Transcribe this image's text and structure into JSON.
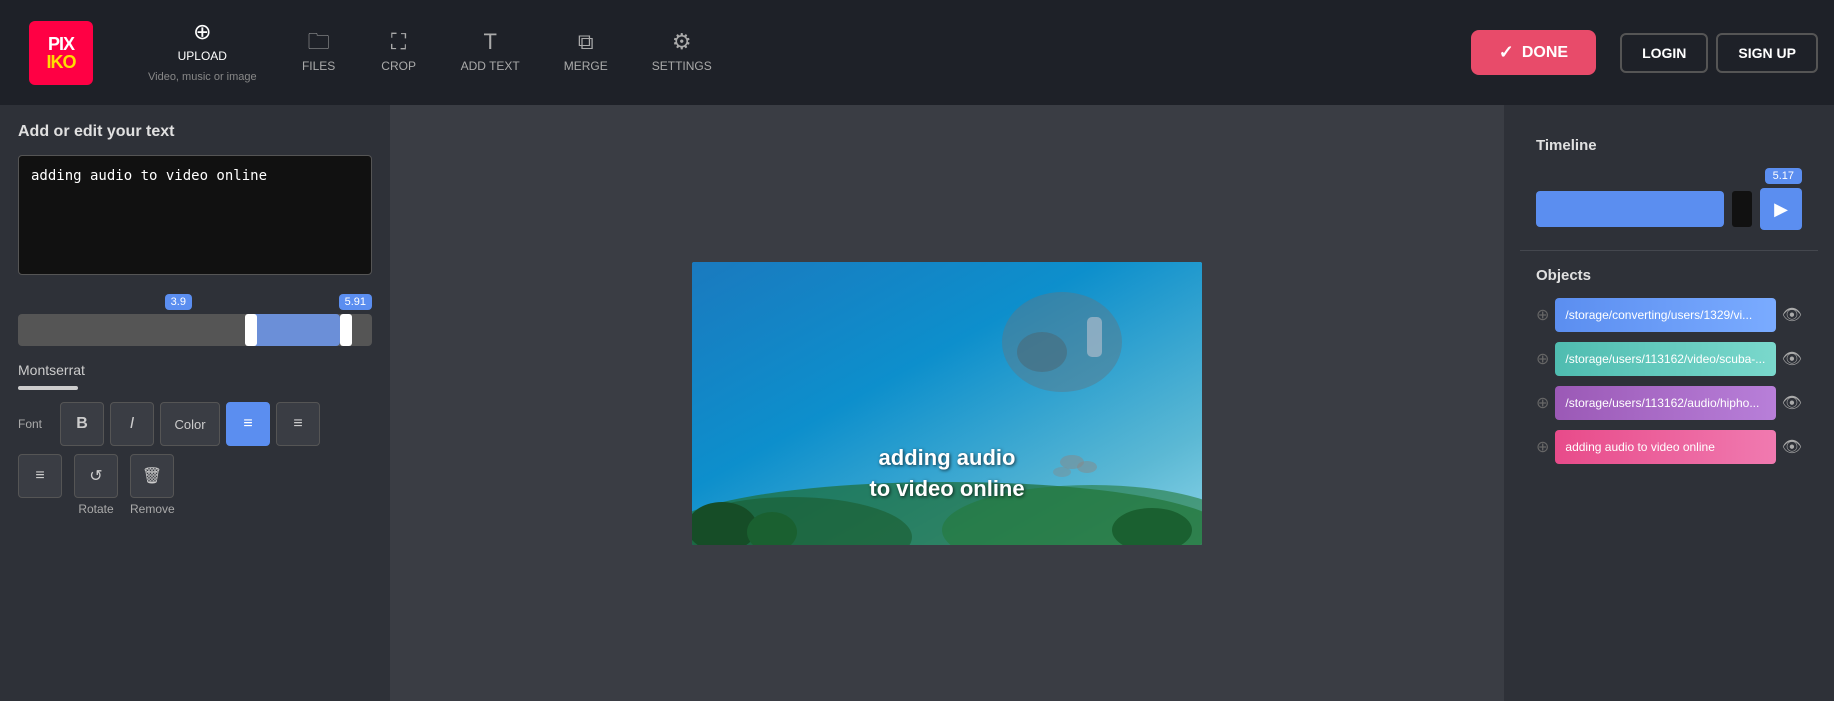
{
  "logo": {
    "text": "PIXIKO",
    "sub": "PIXIKO"
  },
  "topnav": {
    "upload_label": "UPLOAD",
    "upload_sub": "Video, music or image",
    "files_label": "FILES",
    "crop_label": "CROP",
    "addtext_label": "ADD TEXT",
    "merge_label": "MERGE",
    "settings_label": "SETTINGS",
    "done_label": "DONE",
    "login_label": "LOGIN",
    "signup_label": "SIGN UP"
  },
  "left_panel": {
    "title": "Add or edit your text",
    "text_value": "adding audio to video online",
    "slider_left_val": "3.9",
    "slider_right_val": "5.91",
    "font_name": "Montserrat",
    "font_label": "Font",
    "bold_label": "B",
    "italic_label": "I",
    "color_label": "Color",
    "align_left_label": "≡",
    "align_center_label": "≡",
    "rotate_label": "Rotate",
    "remove_label": "Remove"
  },
  "canvas": {
    "overlay_line1": "adding audio",
    "overlay_line2": "to video online"
  },
  "timeline": {
    "title": "Timeline",
    "badge": "5.17",
    "play_icon": "▶"
  },
  "objects": {
    "title": "Objects",
    "items": [
      {
        "path": "/storage/converting/users/1329/vi...",
        "color": "blue"
      },
      {
        "path": "/storage/users/113162/video/scuba-...",
        "color": "teal"
      },
      {
        "path": "/storage/users/113162/audio/hipho...",
        "color": "purple"
      },
      {
        "path": "adding audio to video online",
        "color": "pink"
      }
    ]
  }
}
